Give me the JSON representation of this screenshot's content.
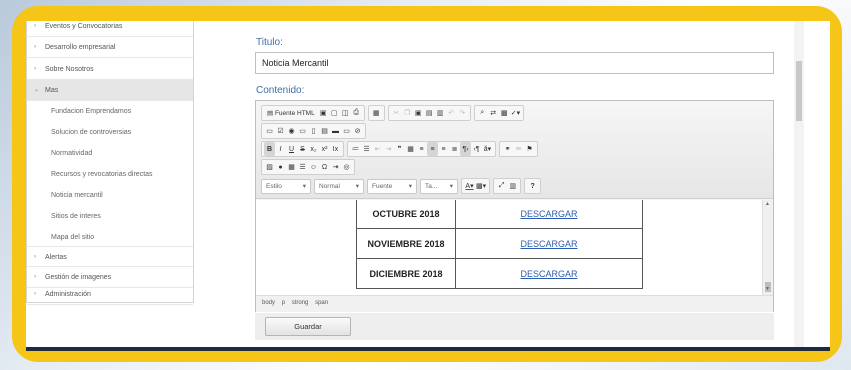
{
  "sidebar": {
    "items": [
      {
        "label": "Eventos y Convocatorias",
        "arrow": "›"
      },
      {
        "label": "Desarrollo empresarial",
        "arrow": "›"
      },
      {
        "label": "Sobre Nosotros",
        "arrow": "›"
      },
      {
        "label": "Mas",
        "arrow": "⌄"
      }
    ],
    "subitems": [
      {
        "label": "Fundacion Emprendamos"
      },
      {
        "label": "Solucion de controversias"
      },
      {
        "label": "Normatividad"
      },
      {
        "label": "Recursos y revocatorias directas"
      },
      {
        "label": "Noticia mercantil"
      },
      {
        "label": "Sitios de interes"
      },
      {
        "label": "Mapa del sitio"
      }
    ],
    "bottom_items": [
      {
        "label": "Alertas",
        "arrow": "›"
      },
      {
        "label": "Gestión de imagenes",
        "arrow": "›"
      },
      {
        "label": "Administración",
        "arrow": "›"
      }
    ]
  },
  "form": {
    "title_label": "Titulo:",
    "title_value": "Noticia Mercantil",
    "content_label": "Contenido:"
  },
  "toolbar": {
    "source_label": "Fuente HTML",
    "style_combo": "Estilo",
    "format_combo": "Normal",
    "font_combo": "Fuente",
    "size_combo": "Ta...",
    "help": "?"
  },
  "table": {
    "rows": [
      {
        "month": "OCTUBRE 2018",
        "link": "DESCARGAR"
      },
      {
        "month": "NOVIEMBRE 2018",
        "link": "DESCARGAR"
      },
      {
        "month": "DICIEMBRE 2018",
        "link": "DESCARGAR"
      }
    ]
  },
  "statusbar": {
    "path": [
      "body",
      "p",
      "strong",
      "span"
    ]
  },
  "actions": {
    "save_label": "Guardar"
  },
  "colors": {
    "frame": "#f5c518",
    "label_blue": "#3f6fa8",
    "link_blue": "#2a5db0"
  }
}
